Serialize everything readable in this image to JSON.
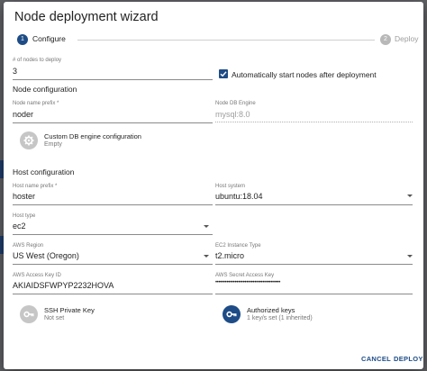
{
  "dialog": {
    "title": "Node deployment wizard"
  },
  "stepper": {
    "steps": [
      {
        "number": "1",
        "label": "Configure"
      },
      {
        "number": "2",
        "label": "Deploy"
      }
    ]
  },
  "node_count": {
    "label": "# of nodes to deploy",
    "value": "3"
  },
  "auto_start": {
    "label": "Automatically start nodes after deployment",
    "checked": true
  },
  "node_config": {
    "heading": "Node configuration",
    "name_prefix": {
      "label": "Node name prefix *",
      "value": "noder"
    },
    "db_engine": {
      "label": "Node DB Engine",
      "value": "mysql:8.0"
    },
    "custom_db": {
      "title": "Custom DB engine configuration",
      "subtitle": "Empty"
    }
  },
  "host_config": {
    "heading": "Host configuration",
    "host_prefix": {
      "label": "Host name prefix *",
      "value": "hoster"
    },
    "host_system": {
      "label": "Host system",
      "value": "ubuntu:18.04"
    },
    "host_type": {
      "label": "Host type",
      "value": "ec2"
    },
    "aws_region": {
      "label": "AWS Region",
      "value": "US West (Oregon)"
    },
    "instance_type": {
      "label": "EC2 Instance Type",
      "value": "t2.micro"
    },
    "access_key": {
      "label": "AWS Access Key ID",
      "value": "AKIAIDSFWPYP2232HOVA"
    },
    "secret_key": {
      "label": "AWS Secret Access Key",
      "value": "••••••••••••••••••••••••••••••••••••••••"
    },
    "ssh_key": {
      "title": "SSH Private Key",
      "subtitle": "Not set"
    },
    "auth_keys": {
      "title": "Authorized keys",
      "subtitle": "1 key/s set (1 inherited)"
    }
  },
  "actions": {
    "cancel": "CANCEL",
    "deploy": "DEPLOY"
  },
  "colors": {
    "primary": "#1d4c86",
    "disabled": "#b8b8b8",
    "backdrop": "#5f6064"
  }
}
